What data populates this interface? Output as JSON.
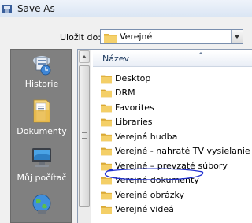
{
  "window": {
    "title": "Save As",
    "icon": "save-as-icon"
  },
  "save_in": {
    "label": "Uložit do:",
    "value": "Verejné",
    "icon": "folder-icon"
  },
  "places": [
    {
      "label": "Historie",
      "icon": "history-icon"
    },
    {
      "label": "Dokumenty",
      "icon": "documents-icon"
    },
    {
      "label": "Můj počítač",
      "icon": "my-computer-icon"
    },
    {
      "label": "",
      "icon": "network-globe-icon"
    }
  ],
  "file_list": {
    "column_header": "Název",
    "items": [
      {
        "label": "Desktop",
        "icon": "folder-icon"
      },
      {
        "label": "DRM",
        "icon": "folder-icon"
      },
      {
        "label": "Favorites",
        "icon": "folder-icon"
      },
      {
        "label": "Libraries",
        "icon": "folder-icon"
      },
      {
        "label": "Verejná hudba",
        "icon": "folder-icon"
      },
      {
        "label": "Verejné - nahraté TV vysielanie",
        "icon": "folder-icon"
      },
      {
        "label": "Verejné – prevzaté súbory",
        "icon": "folder-icon"
      },
      {
        "label": "Verejné dokumenty",
        "icon": "folder-icon",
        "highlighted": true
      },
      {
        "label": "Verejné obrázky",
        "icon": "folder-icon"
      },
      {
        "label": "Verejné videá",
        "icon": "folder-icon"
      }
    ]
  },
  "colors": {
    "places_bar": "#808080",
    "annotation_circle": "#1f2fd0",
    "header_text": "#1e3a5f"
  }
}
